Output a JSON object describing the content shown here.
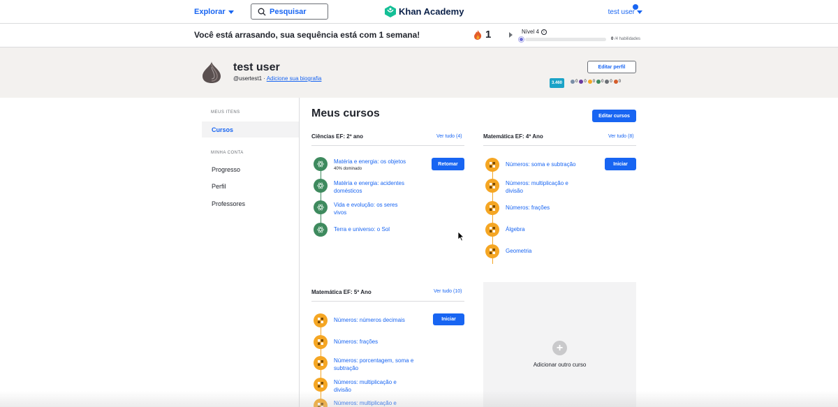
{
  "nav": {
    "explore_label": "Explorar",
    "search_placeholder": "Pesquisar",
    "logo_text": "Khan Academy",
    "user_label": "test user"
  },
  "streak": {
    "message": "Você está arrasando, sua sequência está com 1 semana!",
    "count": "1",
    "level_label": "Nível 4",
    "info_icon_text": "i",
    "skills_done": "0",
    "skills_total": "/4 habilidades",
    "level_progress": 0.0
  },
  "profile": {
    "name": "test user",
    "username": "@usertest1",
    "separator": " · ",
    "bio_link": "Adicione sua biografia",
    "edit_button": "Editar perfil",
    "points": "3.460",
    "badges": [
      "0",
      "0",
      "0",
      "0",
      "0",
      "0"
    ],
    "badge_colors": [
      "#7a8ea6",
      "#6b3b9e",
      "#f5a623",
      "#3e8a5e",
      "#6b6f75",
      "#d45c2a"
    ]
  },
  "sidebar": {
    "section1": "MEUS ITENS",
    "items1": [
      "Cursos"
    ],
    "section2": "MINHA CONTA",
    "items2": [
      "Progresso",
      "Perfil",
      "Professores"
    ]
  },
  "main": {
    "title": "Meus cursos",
    "edit_courses": "Editar cursos",
    "add_course": "Adicionar outro curso",
    "courses": [
      {
        "title": "Ciências EF: 2º ano",
        "see_all": "Ver tudo (4)",
        "action": "Retomar",
        "units": [
          {
            "label": "Matéria e energia: os objetos",
            "sub": "40% dominado"
          },
          {
            "label": "Matéria e energia: acidentes domésticos"
          },
          {
            "label": "Vida e evolução: os seres vivos"
          },
          {
            "label": "Terra e universo: o Sol"
          }
        ]
      },
      {
        "title": "Matemática EF: 4º Ano",
        "see_all": "Ver tudo (8)",
        "action": "Iniciar",
        "units": [
          {
            "label": "Números: soma e subtração"
          },
          {
            "label": "Números: multiplicação e divisão"
          },
          {
            "label": "Números: frações"
          },
          {
            "label": "Álgebra"
          },
          {
            "label": "Geometria"
          }
        ]
      },
      {
        "title": "Matemática EF: 5º Ano",
        "see_all": "Ver tudo (10)",
        "action": "Iniciar",
        "units": [
          {
            "label": "Números: números decimais"
          },
          {
            "label": "Números: frações"
          },
          {
            "label": "Números: porcentagem, soma e subtração"
          },
          {
            "label": "Números: multiplicação e divisão"
          },
          {
            "label": "Números: multiplicação e"
          }
        ]
      }
    ]
  }
}
